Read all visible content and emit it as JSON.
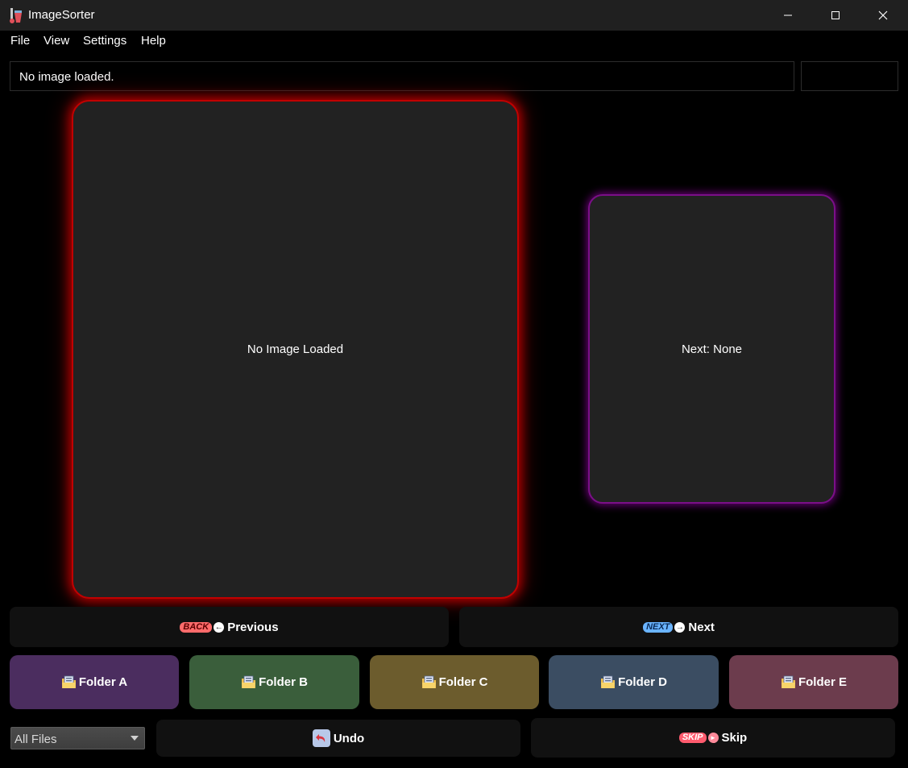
{
  "window": {
    "title": "ImageSorter"
  },
  "menu": [
    "File",
    "View",
    "Settings",
    "Help"
  ],
  "status": {
    "text": "No image loaded."
  },
  "main_panel": {
    "text": "No Image Loaded"
  },
  "next_panel": {
    "text": "Next: None"
  },
  "navigation": {
    "previous_badge": "BACK",
    "previous_label": "Previous",
    "next_badge": "NEXT",
    "next_label": "Next"
  },
  "folders": [
    {
      "label": "Folder A",
      "color": "#4b2d5f"
    },
    {
      "label": "Folder B",
      "color": "#3a5e3b"
    },
    {
      "label": "Folder C",
      "color": "#6c5c2d"
    },
    {
      "label": "Folder D",
      "color": "#3b4d62"
    },
    {
      "label": "Folder E",
      "color": "#6c3c4d"
    }
  ],
  "filter": {
    "selected": "All Files"
  },
  "actions": {
    "undo_label": "Undo",
    "skip_badge": "SKIP",
    "skip_label": "Skip"
  },
  "colors": {
    "main_glow": "#e00000",
    "next_glow": "#a000be"
  }
}
